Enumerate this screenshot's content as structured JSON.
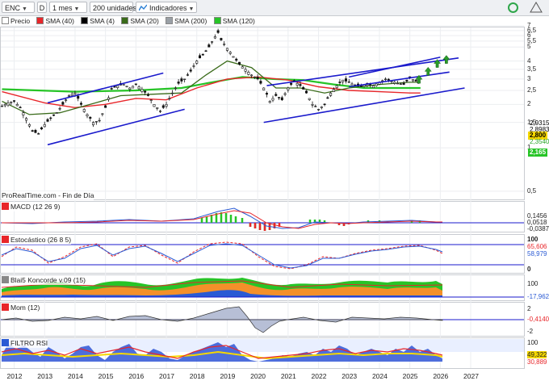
{
  "toolbar": {
    "symbol": "ENC",
    "period_btn": "D",
    "interval": "1 mes",
    "units": "200 unidades",
    "indicators": "Indicadores"
  },
  "legend": [
    {
      "label": "Precio",
      "color": "#ffffff"
    },
    {
      "label": "SMA (40)",
      "color": "#e8262a"
    },
    {
      "label": "SMA (4)",
      "color": "#000000"
    },
    {
      "label": "SMA (20)",
      "color": "#3a6b1a"
    },
    {
      "label": "SMA (200)",
      "color": "#9aa0a6"
    },
    {
      "label": "SMA (120)",
      "color": "#27c427"
    }
  ],
  "source_text": "ProRealTime.com - Fin de Día",
  "panels": {
    "macd": "MACD (12 26 9)",
    "stoch": "Estocástico (26 8 5)",
    "konc": "Blai5 Koncorde v.09 (15)",
    "mom": "Mom (12)",
    "rsi": "FILTRO RSI"
  },
  "price_axis_ticks": [
    "7",
    "6,5",
    "6",
    "5,5",
    "5",
    "4",
    "3,5",
    "3",
    "2,5",
    "2",
    "1,5",
    "1",
    "0,5"
  ],
  "price_labels": {
    "a": "2,9315",
    "b": "2,8983",
    "c": "2,800",
    "d": "2,3540",
    "e": "2,165"
  },
  "macd_axis": [
    "0,1456",
    "0,0518",
    "-0,0387"
  ],
  "stoch_axis": [
    "100",
    "65,606",
    "58,979",
    "0"
  ],
  "konc_axis": [
    "100",
    "-17,962"
  ],
  "mom_axis": [
    "2",
    "-0,4140",
    "-2"
  ],
  "rsi_axis": [
    "100",
    "49,322",
    "30,889"
  ],
  "x_labels": [
    "2012",
    "2013",
    "2014",
    "2015",
    "2016",
    "2017",
    "2018",
    "2019",
    "2020",
    "2021",
    "2022",
    "2023",
    "2024",
    "2025",
    "2026",
    "2027"
  ],
  "colors": {
    "candle": "#111111",
    "sma40": "#e8262a",
    "sma4": "#000000",
    "sma20": "#3a6b1a",
    "sma120": "#27c427",
    "sma200": "#9aa0a6",
    "channel": "#1a1acc",
    "arrow": "#2a9c2a"
  },
  "chart_data": {
    "type": "candlestick",
    "x_start_year": 2011.55,
    "price_series": [
      {
        "date": 2011.6,
        "close": 1.95
      },
      {
        "date": 2011.8,
        "close": 2.05
      },
      {
        "date": 2012.0,
        "close": 2.1
      },
      {
        "date": 2012.2,
        "close": 1.9
      },
      {
        "date": 2012.4,
        "close": 1.6
      },
      {
        "date": 2012.6,
        "close": 1.3
      },
      {
        "date": 2012.8,
        "close": 1.25
      },
      {
        "date": 2013.0,
        "close": 1.45
      },
      {
        "date": 2013.2,
        "close": 1.6
      },
      {
        "date": 2013.4,
        "close": 1.75
      },
      {
        "date": 2013.6,
        "close": 2.0
      },
      {
        "date": 2013.8,
        "close": 2.3
      },
      {
        "date": 2014.0,
        "close": 2.4
      },
      {
        "date": 2014.2,
        "close": 2.0
      },
      {
        "date": 2014.4,
        "close": 1.7
      },
      {
        "date": 2014.6,
        "close": 1.5
      },
      {
        "date": 2014.8,
        "close": 1.55
      },
      {
        "date": 2015.0,
        "close": 1.9
      },
      {
        "date": 2015.2,
        "close": 2.55
      },
      {
        "date": 2015.4,
        "close": 2.7
      },
      {
        "date": 2015.6,
        "close": 2.75
      },
      {
        "date": 2015.8,
        "close": 2.6
      },
      {
        "date": 2016.0,
        "close": 2.75
      },
      {
        "date": 2016.2,
        "close": 2.55
      },
      {
        "date": 2016.4,
        "close": 2.3
      },
      {
        "date": 2016.6,
        "close": 2.0
      },
      {
        "date": 2016.8,
        "close": 1.8
      },
      {
        "date": 2017.0,
        "close": 2.0
      },
      {
        "date": 2017.2,
        "close": 2.4
      },
      {
        "date": 2017.4,
        "close": 2.8
      },
      {
        "date": 2017.6,
        "close": 3.0
      },
      {
        "date": 2017.8,
        "close": 3.4
      },
      {
        "date": 2018.0,
        "close": 4.0
      },
      {
        "date": 2018.2,
        "close": 4.4
      },
      {
        "date": 2018.4,
        "close": 5.0
      },
      {
        "date": 2018.6,
        "close": 5.9
      },
      {
        "date": 2018.7,
        "close": 6.3
      },
      {
        "date": 2018.8,
        "close": 5.6
      },
      {
        "date": 2019.0,
        "close": 4.9
      },
      {
        "date": 2019.2,
        "close": 4.3
      },
      {
        "date": 2019.4,
        "close": 3.8
      },
      {
        "date": 2019.6,
        "close": 3.5
      },
      {
        "date": 2019.8,
        "close": 3.2
      },
      {
        "date": 2020.0,
        "close": 3.0
      },
      {
        "date": 2020.2,
        "close": 2.6
      },
      {
        "date": 2020.4,
        "close": 2.1
      },
      {
        "date": 2020.6,
        "close": 2.3
      },
      {
        "date": 2020.8,
        "close": 2.15
      },
      {
        "date": 2021.0,
        "close": 2.6
      },
      {
        "date": 2021.2,
        "close": 2.9
      },
      {
        "date": 2021.4,
        "close": 2.7
      },
      {
        "date": 2021.6,
        "close": 2.4
      },
      {
        "date": 2021.8,
        "close": 2.0
      },
      {
        "date": 2022.0,
        "close": 1.85
      },
      {
        "date": 2022.2,
        "close": 2.0
      },
      {
        "date": 2022.4,
        "close": 2.4
      },
      {
        "date": 2022.6,
        "close": 2.7
      },
      {
        "date": 2022.8,
        "close": 2.95
      },
      {
        "date": 2023.0,
        "close": 2.85
      },
      {
        "date": 2023.2,
        "close": 2.7
      },
      {
        "date": 2023.4,
        "close": 2.65
      },
      {
        "date": 2023.6,
        "close": 2.8
      },
      {
        "date": 2023.8,
        "close": 2.7
      },
      {
        "date": 2024.0,
        "close": 2.85
      },
      {
        "date": 2024.2,
        "close": 3.0
      },
      {
        "date": 2024.4,
        "close": 2.9
      },
      {
        "date": 2024.6,
        "close": 2.8
      },
      {
        "date": 2024.8,
        "close": 2.75
      },
      {
        "date": 2025.0,
        "close": 3.05
      },
      {
        "date": 2025.2,
        "close": 2.9
      },
      {
        "date": 2025.35,
        "close": 2.8
      }
    ],
    "sma": {
      "sma40": [
        [
          2011.6,
          2.45
        ],
        [
          2013,
          2.05
        ],
        [
          2014,
          1.9
        ],
        [
          2015,
          2.0
        ],
        [
          2016,
          2.2
        ],
        [
          2017,
          2.15
        ],
        [
          2018,
          2.6
        ],
        [
          2019,
          3.0
        ],
        [
          2020,
          3.1
        ],
        [
          2021,
          2.95
        ],
        [
          2022,
          2.65
        ],
        [
          2023,
          2.5
        ],
        [
          2024,
          2.45
        ],
        [
          2025,
          2.4
        ],
        [
          2025.35,
          2.4
        ]
      ],
      "sma20": [
        [
          2011.6,
          2.1
        ],
        [
          2012.5,
          1.7
        ],
        [
          2013.5,
          1.75
        ],
        [
          2014.5,
          2.0
        ],
        [
          2015.5,
          2.3
        ],
        [
          2016.5,
          2.35
        ],
        [
          2017.5,
          2.4
        ],
        [
          2018.3,
          3.2
        ],
        [
          2019,
          4.0
        ],
        [
          2019.8,
          3.6
        ],
        [
          2020.6,
          2.6
        ],
        [
          2021.4,
          2.6
        ],
        [
          2022.2,
          2.4
        ],
        [
          2023,
          2.6
        ],
        [
          2024,
          2.75
        ],
        [
          2025,
          2.85
        ],
        [
          2025.35,
          2.85
        ]
      ],
      "sma120": [
        [
          2011.6,
          2.55
        ],
        [
          2014,
          2.45
        ],
        [
          2016,
          2.5
        ],
        [
          2017.5,
          2.6
        ],
        [
          2018.5,
          2.85
        ],
        [
          2019.5,
          3.1
        ],
        [
          2020.5,
          3.0
        ],
        [
          2021.5,
          2.95
        ],
        [
          2022.5,
          2.75
        ],
        [
          2023.5,
          2.6
        ],
        [
          2024.5,
          2.6
        ],
        [
          2025.35,
          2.6
        ]
      ]
    },
    "channels": [
      {
        "name": "channel-2013-upper",
        "from": [
          2013.1,
          2.05
        ],
        "to": [
          2016.9,
          3.3
        ]
      },
      {
        "name": "channel-2013-lower",
        "from": [
          2013.1,
          1.05
        ],
        "to": [
          2017.6,
          1.85
        ]
      },
      {
        "name": "channel-2020-upper",
        "from": [
          2020.3,
          2.7
        ],
        "to": [
          2026.6,
          4.2
        ]
      },
      {
        "name": "channel-2020-lower",
        "from": [
          2020.2,
          1.5
        ],
        "to": [
          2026.8,
          2.6
        ]
      },
      {
        "name": "channel-2022-upper",
        "from": [
          2023.0,
          3.1
        ],
        "to": [
          2026.0,
          4.25
        ]
      },
      {
        "name": "channel-2022-mid",
        "from": [
          2023.0,
          2.65
        ],
        "to": [
          2026.3,
          3.35
        ]
      }
    ],
    "arrows": [
      [
        2025.3,
        2.95
      ],
      [
        2025.6,
        3.35
      ],
      [
        2025.9,
        3.8
      ],
      [
        2026.2,
        4.05
      ]
    ],
    "ylim": [
      0.4,
      7.2
    ]
  }
}
